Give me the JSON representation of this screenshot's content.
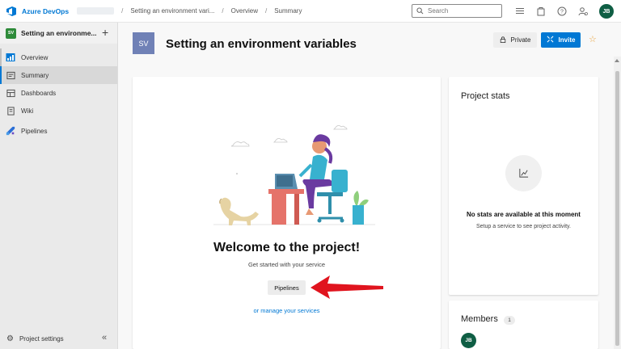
{
  "topbar": {
    "brand": "Azure DevOps",
    "breadcrumbs": [
      "Setting an environment vari...",
      "Overview",
      "Summary"
    ],
    "search_placeholder": "Search",
    "user_initials": "JB"
  },
  "sidebar": {
    "project_initials": "SV",
    "project_name": "Setting an environme...",
    "items": [
      {
        "label": "Overview",
        "icon": "overview-icon"
      },
      {
        "label": "Summary",
        "icon": "summary-icon"
      },
      {
        "label": "Dashboards",
        "icon": "dashboards-icon"
      },
      {
        "label": "Wiki",
        "icon": "wiki-icon"
      },
      {
        "label": "Pipelines",
        "icon": "pipelines-icon"
      }
    ],
    "settings_label": "Project settings"
  },
  "header": {
    "project_initials": "SV",
    "title": "Setting an environment variables",
    "private_label": "Private",
    "invite_label": "Invite"
  },
  "welcome": {
    "title": "Welcome to the project!",
    "subtitle": "Get started with your service",
    "pipelines_button": "Pipelines",
    "manage_link": "or manage your services"
  },
  "stats": {
    "title": "Project stats",
    "empty_message": "No stats are available at this moment",
    "hint": "Setup a service to see project activity."
  },
  "members": {
    "title": "Members",
    "count": "1",
    "avatar_initials": "JB"
  },
  "colors": {
    "accent": "#0078d4",
    "project_badge": "#2e8b3a",
    "project_tile": "#7081b6",
    "avatar": "#0f5e44",
    "arrow": "#e0141e"
  }
}
